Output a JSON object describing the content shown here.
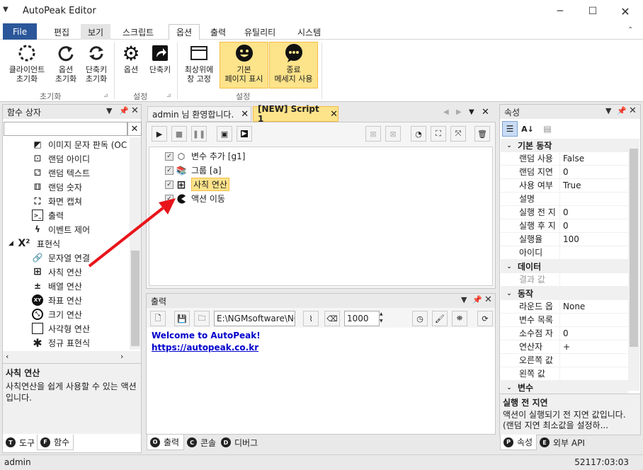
{
  "window": {
    "title": "AutoPeak Editor"
  },
  "ribbon_tabs": [
    "File",
    "편집",
    "보기",
    "스크립트",
    "옵션",
    "출력",
    "유틸리티",
    "시스템"
  ],
  "ribbon": {
    "groups": [
      {
        "name": "초기화",
        "buttons": [
          {
            "label1": "클라이언트",
            "label2": "초기화"
          },
          {
            "label1": "옵션",
            "label2": "초기화"
          },
          {
            "label1": "단축키",
            "label2": "초기화"
          }
        ]
      },
      {
        "name": "설정",
        "buttons": [
          {
            "label1": "옵션",
            "label2": ""
          },
          {
            "label1": "단축키",
            "label2": ""
          }
        ]
      },
      {
        "name": "설정",
        "buttons": [
          {
            "label1": "최상위에",
            "label2": "창 고정"
          },
          {
            "label1": "기본",
            "label2": "페이지 표시"
          },
          {
            "label1": "종료",
            "label2": "메세지 사용"
          }
        ]
      }
    ]
  },
  "function_panel": {
    "title": "함수 상자",
    "search_value": "",
    "items": [
      {
        "label": "이미지 문자 판독 (OC",
        "icon": "ocr-icon"
      },
      {
        "label": "랜덤 아이디",
        "icon": "dice-icon"
      },
      {
        "label": "랜덤 텍스트",
        "icon": "dice-icon"
      },
      {
        "label": "랜덤 숫자",
        "icon": "dice-icon"
      },
      {
        "label": "화면 캡쳐",
        "icon": "screen-capture-icon"
      },
      {
        "label": "출력",
        "icon": "console-icon"
      },
      {
        "label": "이벤트 제어",
        "icon": "lightning-icon"
      }
    ],
    "category": {
      "label": "표현식",
      "icon": "x-squared-icon"
    },
    "sub_items": [
      {
        "label": "문자열 연결",
        "icon": "link-icon"
      },
      {
        "label": "사칙 연산",
        "icon": "calculator-icon"
      },
      {
        "label": "배열 연산",
        "icon": "plus-minus-icon"
      },
      {
        "label": "좌표 연산",
        "icon": "xy-icon"
      },
      {
        "label": "크기 연산",
        "icon": "resize-icon"
      },
      {
        "label": "사각형 연산",
        "icon": "rectangle-icon"
      },
      {
        "label": "정규 표현식",
        "icon": "asterisk-icon"
      }
    ],
    "desc_title": "사칙 연산",
    "desc_text": "사칙연산을 쉽게 사용할 수 있는 액션입니다.",
    "bottom_tabs": [
      {
        "letter": "T",
        "label": "도구"
      },
      {
        "letter": "F",
        "label": "함수"
      }
    ]
  },
  "doc_tabs": [
    {
      "label": "admin 님 환영합니다."
    },
    {
      "label": "[NEW] Script 1"
    }
  ],
  "script": {
    "rows": [
      {
        "label": "변수 추가 [g1]",
        "icon": "cube-icon"
      },
      {
        "label": "그룹 [a]",
        "icon": "book-icon"
      },
      {
        "label": "사칙 연산",
        "icon": "calculator-icon"
      },
      {
        "label": "액션 이동",
        "icon": "pacman-icon"
      }
    ]
  },
  "output_panel": {
    "title": "출력",
    "path_value": "E:\\NGMsoftware\\NG",
    "count_value": "1000",
    "lines": [
      "Welcome to AutoPeak!",
      "https://autopeak.co.kr"
    ],
    "bottom_tabs": [
      {
        "letter": "O",
        "label": "출력"
      },
      {
        "letter": "C",
        "label": "콘솔"
      },
      {
        "letter": "D",
        "label": "디버그"
      }
    ]
  },
  "properties": {
    "title": "속성",
    "categories": [
      {
        "name": "기본 동작",
        "rows": [
          {
            "name": "랜덤 사용",
            "value": "False"
          },
          {
            "name": "랜덤 지연",
            "value": "0"
          },
          {
            "name": "사용 여부",
            "value": "True"
          },
          {
            "name": "설명",
            "value": ""
          },
          {
            "name": "실행 전 지",
            "value": "0"
          },
          {
            "name": "실행 후 지",
            "value": "0"
          },
          {
            "name": "실행율",
            "value": "100"
          },
          {
            "name": "아이디",
            "value": ""
          }
        ]
      },
      {
        "name": "데이터",
        "rows": [
          {
            "name": "결과 값",
            "value": ""
          }
        ]
      },
      {
        "name": "동작",
        "rows": [
          {
            "name": "라운드 옵",
            "value": "None"
          },
          {
            "name": "변수 목록",
            "value": ""
          },
          {
            "name": "소수점 자",
            "value": "0"
          },
          {
            "name": "연산자",
            "value": "+"
          },
          {
            "name": "오른쪽 값",
            "value": ""
          },
          {
            "name": "왼쪽 값",
            "value": ""
          }
        ]
      },
      {
        "name": "변수",
        "rows": []
      }
    ],
    "desc_title": "실행 전 지연",
    "desc_text": "액션이 실행되기 전 지연 값입니다. (랜덤 지연 최소값을 설정하...",
    "bottom_tabs": [
      {
        "letter": "P",
        "label": "속성"
      },
      {
        "letter": "E",
        "label": "외부 API"
      }
    ]
  },
  "status": {
    "user": "admin",
    "time": "52117:03:03"
  },
  "colors": {
    "file_tab": "#2b579a",
    "highlight": "#fde38a",
    "link": "#0000cc",
    "arrow": "#e8141a"
  }
}
